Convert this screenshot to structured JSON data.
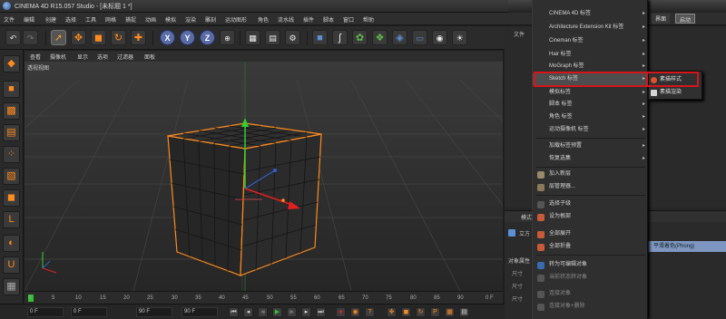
{
  "app": {
    "title": "CINEMA 4D R15.057 Studio - [未标题 1 *]"
  },
  "menubar": {
    "items": [
      "文件",
      "编辑",
      "创建",
      "选择",
      "工具",
      "网格",
      "捕捉",
      "动画",
      "模拟",
      "渲染",
      "雕刻",
      "运动图形",
      "角色",
      "流水线",
      "插件",
      "脚本",
      "窗口",
      "帮助"
    ]
  },
  "layout": {
    "label": "界面",
    "value": "启动"
  },
  "viewport": {
    "menu": [
      "查看",
      "摄像机",
      "显示",
      "选项",
      "过滤器",
      "面板"
    ],
    "label": "透视视图"
  },
  "objects_panel": {
    "tab": "文件"
  },
  "timeline": {
    "ticks": [
      "0",
      "5",
      "10",
      "15",
      "20",
      "25",
      "30",
      "35",
      "40",
      "45",
      "50",
      "55",
      "60",
      "65",
      "70",
      "75",
      "80",
      "85",
      "90"
    ],
    "end_tick": "0 F"
  },
  "transport": {
    "start_field": "0 F",
    "current_field": "0 F",
    "end_field": "90 F",
    "end_field2": "90 F"
  },
  "attributes": {
    "mode_label": "模式",
    "object_label": "立方",
    "props_label": "对象属性",
    "rows": [
      "尺寸",
      "尺寸",
      "尺寸",
      "分段",
      "分段",
      "分段"
    ],
    "phong": "平滑着色(Phong)"
  },
  "context_menu": {
    "items": [
      {
        "label": "CINEMA 4D 标签",
        "submenu": true
      },
      {
        "label": "Architecture Extension Kit 标签",
        "submenu": true
      },
      {
        "label": "Cineman 标签",
        "submenu": true
      },
      {
        "label": "Hair 标签",
        "submenu": true
      },
      {
        "label": "MoGraph 标签",
        "submenu": true
      },
      {
        "label": "Sketch 标签",
        "submenu": true,
        "active": true
      },
      {
        "label": "模拟标签",
        "submenu": true
      },
      {
        "label": "脚本 标签",
        "submenu": true
      },
      {
        "label": "角色 标签",
        "submenu": true
      },
      {
        "label": "运动摄像机 标签",
        "submenu": true
      },
      {
        "label": "加载标签预置",
        "submenu": true
      },
      {
        "label": "恢复选集",
        "submenu": true
      },
      {
        "label": "加入新层",
        "submenu": false
      },
      {
        "label": "层管理器...",
        "submenu": false
      },
      {
        "label": "选择子级",
        "submenu": false
      },
      {
        "label": "设为根部",
        "submenu": false
      },
      {
        "label": "全部展开",
        "submenu": false
      },
      {
        "label": "全部折叠",
        "submenu": false
      },
      {
        "label": "转为可编辑对象",
        "submenu": false
      },
      {
        "label": "当前状态转对象",
        "submenu": false
      },
      {
        "label": "连接对象",
        "submenu": false
      },
      {
        "label": "连接对象+删除",
        "submenu": false
      }
    ]
  },
  "sketch_submenu": {
    "items": [
      "素描样式",
      "素描渲染"
    ]
  },
  "colors": {
    "highlight": "#d4161b",
    "accent_orange": "#ff8a1d",
    "axis_blue": "#5a6ca8"
  }
}
